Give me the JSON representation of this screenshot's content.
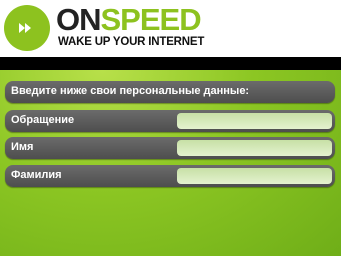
{
  "brand": {
    "name_part1": "ON",
    "name_part2": "SPEED",
    "tagline": "WAKE UP YOUR INTERNET"
  },
  "form": {
    "heading": "Введите ниже свои персональные данные:",
    "fields": [
      {
        "label": "Обращение",
        "value": ""
      },
      {
        "label": "Имя",
        "value": ""
      },
      {
        "label": "Фамилия",
        "value": ""
      }
    ]
  },
  "colors": {
    "accent": "#8dc21f",
    "background": "#7fbf1f",
    "row": "#5a5a5a"
  }
}
